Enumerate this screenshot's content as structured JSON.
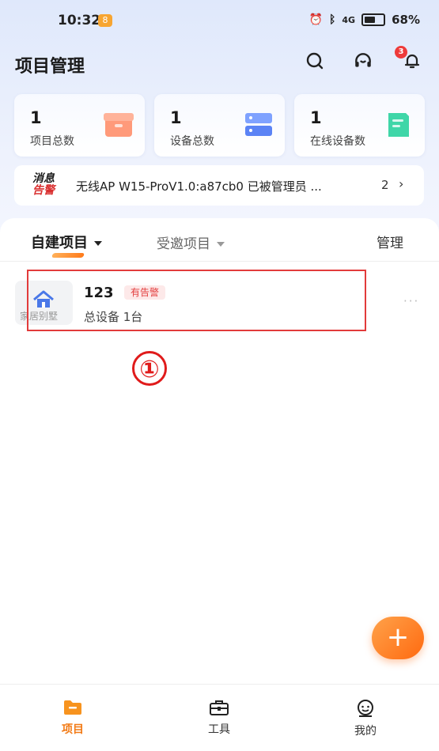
{
  "status_bar": {
    "time": "10:32",
    "time_badge": "8",
    "battery": "68%",
    "signal": "4G"
  },
  "header": {
    "title": "项目管理",
    "notification_count": "3"
  },
  "stats": [
    {
      "value": "1",
      "label": "项目总数"
    },
    {
      "value": "1",
      "label": "设备总数"
    },
    {
      "value": "1",
      "label": "在线设备数"
    }
  ],
  "message": {
    "tag_line1": "消息",
    "tag_line2": "告警",
    "text": "无线AP W15-ProV1.0:a87cb0 已被管理员 ...",
    "count": "2",
    "chevron": "›"
  },
  "tabs": {
    "active": "自建项目",
    "other": "受邀项目",
    "manage": "管理"
  },
  "project": {
    "thumb_label": "家居别墅",
    "name": "123",
    "badge": "有告警",
    "subtitle": "总设备 1台",
    "more": "···"
  },
  "annotation": {
    "marker": "①"
  },
  "fab": {
    "label": "+"
  },
  "bottom_nav": [
    {
      "label": "项目",
      "icon": "folder-icon"
    },
    {
      "label": "工具",
      "icon": "toolbox-icon"
    },
    {
      "label": "我的",
      "icon": "user-face-icon"
    }
  ],
  "colors": {
    "accent": "#f27a15",
    "alert": "#e34040",
    "highlight": "#e23b3b"
  }
}
